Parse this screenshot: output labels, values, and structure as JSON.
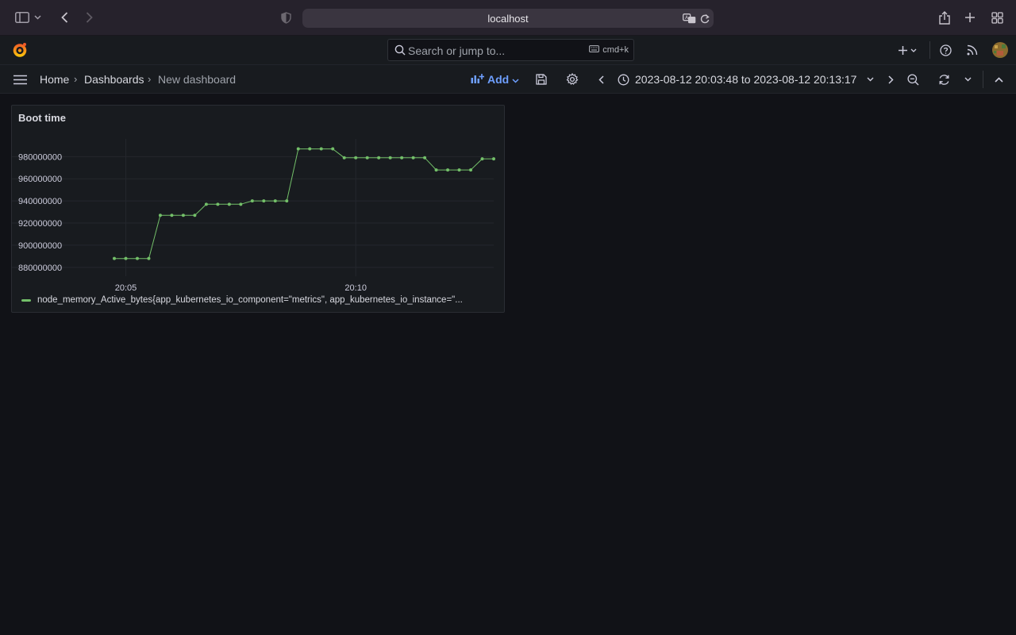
{
  "browser": {
    "url": "localhost"
  },
  "topnav": {
    "search_placeholder": "Search or jump to...",
    "shortcut": "cmd+k"
  },
  "breadcrumb": {
    "home": "Home",
    "dashboards": "Dashboards",
    "current": "New dashboard",
    "separator": "›"
  },
  "toolbar": {
    "add_label": "Add",
    "time_range": "2023-08-12 20:03:48 to 2023-08-12 20:13:17"
  },
  "panel": {
    "title": "Boot time",
    "legend_label": "node_memory_Active_bytes{app_kubernetes_io_component=\"metrics\", app_kubernetes_io_instance=\"..."
  },
  "colors": {
    "series": "#73bf69",
    "accent": "#6e9fff"
  },
  "chart_data": {
    "type": "line",
    "title": "Boot time",
    "xlabel": "",
    "ylabel": "",
    "x_ticks": [
      "20:05",
      "20:10"
    ],
    "y_ticks": [
      "880000000",
      "900000000",
      "920000000",
      "940000000",
      "960000000",
      "980000000"
    ],
    "ylim": [
      872000000,
      996000000
    ],
    "grid": true,
    "legend": "bottom-left",
    "series": [
      {
        "name": "node_memory_Active_bytes{app_kubernetes_io_component=\"metrics\", app_kubernetes_io_instance=\"...",
        "x": [
          "20:04:45",
          "20:05:00",
          "20:05:15",
          "20:05:30",
          "20:05:45",
          "20:06:00",
          "20:06:15",
          "20:06:30",
          "20:06:45",
          "20:07:00",
          "20:07:15",
          "20:07:30",
          "20:07:45",
          "20:08:00",
          "20:08:15",
          "20:08:30",
          "20:08:45",
          "20:09:00",
          "20:09:15",
          "20:09:30",
          "20:09:45",
          "20:10:00",
          "20:10:15",
          "20:10:30",
          "20:10:45",
          "20:11:00",
          "20:11:15",
          "20:11:30",
          "20:11:45",
          "20:12:00",
          "20:12:15",
          "20:12:30",
          "20:12:45",
          "20:13:00"
        ],
        "values": [
          888000000,
          888000000,
          888000000,
          888000000,
          927000000,
          927000000,
          927000000,
          927000000,
          937000000,
          937000000,
          937000000,
          937000000,
          940000000,
          940000000,
          940000000,
          940000000,
          987000000,
          987000000,
          987000000,
          987000000,
          979000000,
          979000000,
          979000000,
          979000000,
          979000000,
          979000000,
          979000000,
          979000000,
          968000000,
          968000000,
          968000000,
          968000000,
          978000000,
          978000000
        ]
      }
    ]
  }
}
